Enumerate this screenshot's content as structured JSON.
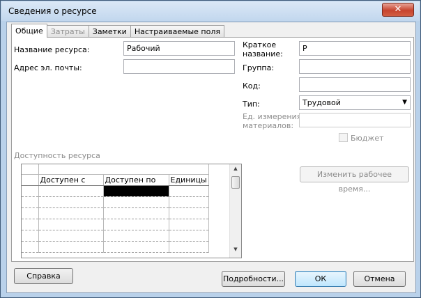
{
  "window": {
    "title": "Сведения о ресурсе",
    "close_glyph": "✕"
  },
  "tabs": [
    {
      "label": "Общие",
      "state": "active"
    },
    {
      "label": "Затраты",
      "state": "disabled"
    },
    {
      "label": "Заметки",
      "state": "normal"
    },
    {
      "label": "Настраиваемые поля",
      "state": "normal"
    }
  ],
  "form": {
    "resource_name_label": "Название ресурса:",
    "resource_name_value": "Рабочий",
    "email_label": "Адрес эл. почты:",
    "email_value": "",
    "short_name_label_1": "Краткое",
    "short_name_label_2": "название:",
    "short_name_value": "Р",
    "group_label": "Группа:",
    "group_value": "",
    "code_label": "Код:",
    "code_value": "",
    "type_label": "Тип:",
    "type_value": "Трудовой",
    "material_label_1": "Ед. измерения",
    "material_label_2": "материалов:",
    "material_value": "",
    "budget_label": "Бюджет",
    "budget_checked": false
  },
  "availability": {
    "section_label": "Доступность ресурса",
    "columns": [
      "Доступен с",
      "Доступен по",
      "Единицы"
    ],
    "rows": [
      [
        "",
        "",
        ""
      ],
      [
        "",
        "",
        ""
      ],
      [
        "",
        "",
        ""
      ],
      [
        "",
        "",
        ""
      ],
      [
        "",
        "",
        ""
      ],
      [
        "",
        "",
        ""
      ]
    ],
    "change_time_button": "Изменить рабочее время..."
  },
  "footer": {
    "help_button": "Справка",
    "details_button": "Подробности...",
    "ok_button": "ОК",
    "cancel_button": "Отмена"
  }
}
